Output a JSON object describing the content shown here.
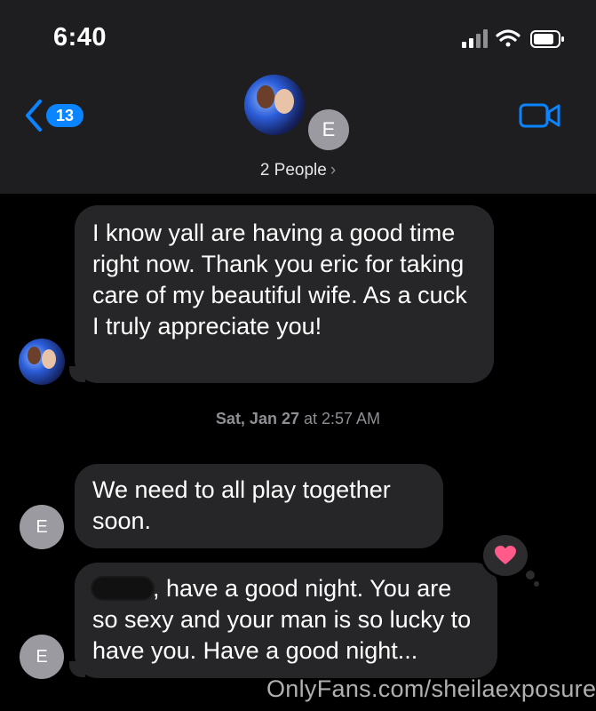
{
  "status_bar": {
    "time": "6:40"
  },
  "header": {
    "back_count": "13",
    "avatar_letter": "E",
    "group_label": "2 People",
    "chevron": "›"
  },
  "messages": [
    {
      "sender_avatar": "photo",
      "text": "I know yall are having a good time right now. Thank you eric for taking care of my beautiful wife. As a cuck I truly appreciate you!"
    },
    {
      "sender_avatar": "E",
      "text": "We need to all play together soon."
    },
    {
      "sender_avatar": "E",
      "text": ", have a good night. You are so sexy and your man is so lucky to have you. Have a good night...",
      "reaction": "heart-icon"
    }
  ],
  "timestamp": {
    "day": "Sat, Jan 27",
    "time": "at 2:57 AM"
  },
  "watermark": "OnlyFans.com/sheilaexposure",
  "colors": {
    "accent": "#0a84ff",
    "bubble": "#262628",
    "heart": "#ff5a8a"
  }
}
